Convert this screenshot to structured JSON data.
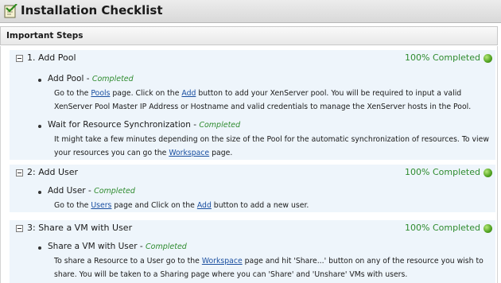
{
  "window": {
    "title": "Installation Checklist"
  },
  "section": {
    "header": "Important Steps"
  },
  "steps": [
    {
      "title": "1. Add Pool",
      "status": "100% Completed",
      "tasks": [
        {
          "title": "Add Pool",
          "status": "Completed",
          "desc": {
            "t1": "Go to the ",
            "l1": "Pools",
            "t2": " page. Click on the ",
            "l2": "Add",
            "t3": " button to add your XenServer pool. You will be required to input a valid XenServer Pool Master IP Address or Hostname and valid credentials to manage the XenServer hosts in the Pool."
          }
        },
        {
          "title": "Wait for Resource Synchronization",
          "status": "Completed",
          "desc": {
            "t1": "It might take a few minutes depending on the size of the Pool for the automatic synchronization of resources. To view your resources you can go the ",
            "l1": "Workspace",
            "t2": " page."
          }
        }
      ]
    },
    {
      "title": "2: Add User",
      "status": "100% Completed",
      "tasks": [
        {
          "title": "Add User",
          "status": "Completed",
          "desc": {
            "t1": "Go to the ",
            "l1": "Users",
            "t2": " page and Click on the ",
            "l2": "Add",
            "t3": " button to add a new user."
          }
        }
      ]
    },
    {
      "title": "3: Share a VM with User",
      "status": "100% Completed",
      "tasks": [
        {
          "title": "Share a VM with User",
          "status": "Completed",
          "desc": {
            "t1": "To share a Resource to a User go to the ",
            "l1": "Workspace",
            "t2": " page and hit 'Share...' button on any of the resource you wish to share. You will be taken to a Sharing page where you can 'Share' and 'Unshare' VMs with users."
          }
        }
      ]
    }
  ],
  "colors": {
    "completed": "#2e8b2e",
    "link": "#1a4fa0",
    "step_bg": "#eef5fb"
  },
  "icons": {
    "title": "checklist-icon",
    "toggle": "collapse-icon",
    "status": "status-ok-icon"
  }
}
